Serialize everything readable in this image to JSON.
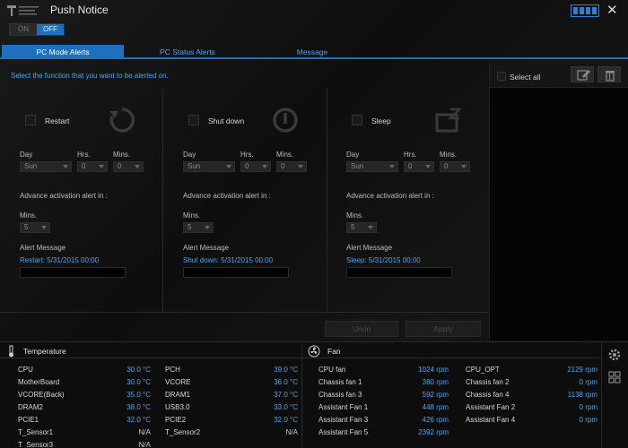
{
  "app": {
    "title": "Push Notice"
  },
  "toggle": {
    "on": "ON",
    "off": "OFF"
  },
  "tabs": [
    "PC Mode Alerts",
    "PC Status Alerts",
    "Message"
  ],
  "main": {
    "hint": "Select the function that you want to be alerted on.",
    "columns": [
      {
        "function": "Restart",
        "icon": "restart-icon",
        "day_label": "Day",
        "hrs_label": "Hrs.",
        "mins_label": "Mins.",
        "day": "Sun",
        "hrs": "0",
        "mins": "0",
        "adv_label": "Advance activation alert in :",
        "adv_mins_label": "Mins.",
        "adv_mins": "5",
        "msg_label": "Alert Message",
        "msg": "Restart: 5/31/2015 00:00"
      },
      {
        "function": "Shut down",
        "icon": "power-icon",
        "day_label": "Day",
        "hrs_label": "Hrs.",
        "mins_label": "Mins.",
        "day": "Sun",
        "hrs": "0",
        "mins": "0",
        "adv_label": "Advance activation alert in :",
        "adv_mins_label": "Mins.",
        "adv_mins": "5",
        "msg_label": "Alert Message",
        "msg": "Shut down: 5/31/2015 00:00"
      },
      {
        "function": "Sleep",
        "icon": "sleep-icon",
        "day_label": "Day",
        "hrs_label": "Hrs.",
        "mins_label": "Mins.",
        "day": "Sun",
        "hrs": "0",
        "mins": "0",
        "adv_label": "Advance activation alert in :",
        "adv_mins_label": "Mins.",
        "adv_mins": "5",
        "msg_label": "Alert Message",
        "msg": "Sleep: 5/31/2015 00:00"
      }
    ],
    "undo": "Undo",
    "apply": "Apply"
  },
  "right": {
    "select_all": "Select all"
  },
  "temperature": {
    "title": "Temperature",
    "left": [
      {
        "name": "CPU",
        "value": "30.0 °C"
      },
      {
        "name": "MotherBoard",
        "value": "30.0 °C"
      },
      {
        "name": "VCORE(Back)",
        "value": "35.0 °C"
      },
      {
        "name": "DRAM2",
        "value": "38.0 °C"
      },
      {
        "name": "PCIE1",
        "value": "32.0 °C"
      },
      {
        "name": "T_Sensor1",
        "value": "N/A"
      },
      {
        "name": "T_Sensor3",
        "value": "N/A"
      }
    ],
    "right": [
      {
        "name": "PCH",
        "value": "39.0 °C"
      },
      {
        "name": "VCORE",
        "value": "36.0 °C"
      },
      {
        "name": "DRAM1",
        "value": "37.0 °C"
      },
      {
        "name": "USB3.0",
        "value": "33.0 °C"
      },
      {
        "name": "PCIE2",
        "value": "32.0 °C"
      },
      {
        "name": "T_Sensor2",
        "value": "N/A"
      }
    ]
  },
  "fan": {
    "title": "Fan",
    "left": [
      {
        "name": "CPU fan",
        "value": "1024 rpm"
      },
      {
        "name": "Chassis fan 1",
        "value": "380 rpm"
      },
      {
        "name": "Chassis fan 3",
        "value": "592 rpm"
      },
      {
        "name": "Assistant Fan 1",
        "value": "448 rpm"
      },
      {
        "name": "Assistant Fan 3",
        "value": "426 rpm"
      },
      {
        "name": "Assistant Fan 5",
        "value": "2392 rpm"
      }
    ],
    "right": [
      {
        "name": "CPU_OPT",
        "value": "2129 rpm"
      },
      {
        "name": "Chassis fan 2",
        "value": "0 rpm"
      },
      {
        "name": "Chassis fan 4",
        "value": "1138 rpm"
      },
      {
        "name": "Assistant Fan 2",
        "value": "0 rpm"
      },
      {
        "name": "Assistant Fan 4",
        "value": "0 rpm"
      }
    ]
  },
  "colors": {
    "accent": "#1d6fc0",
    "value_text": "#4aa6ea"
  }
}
